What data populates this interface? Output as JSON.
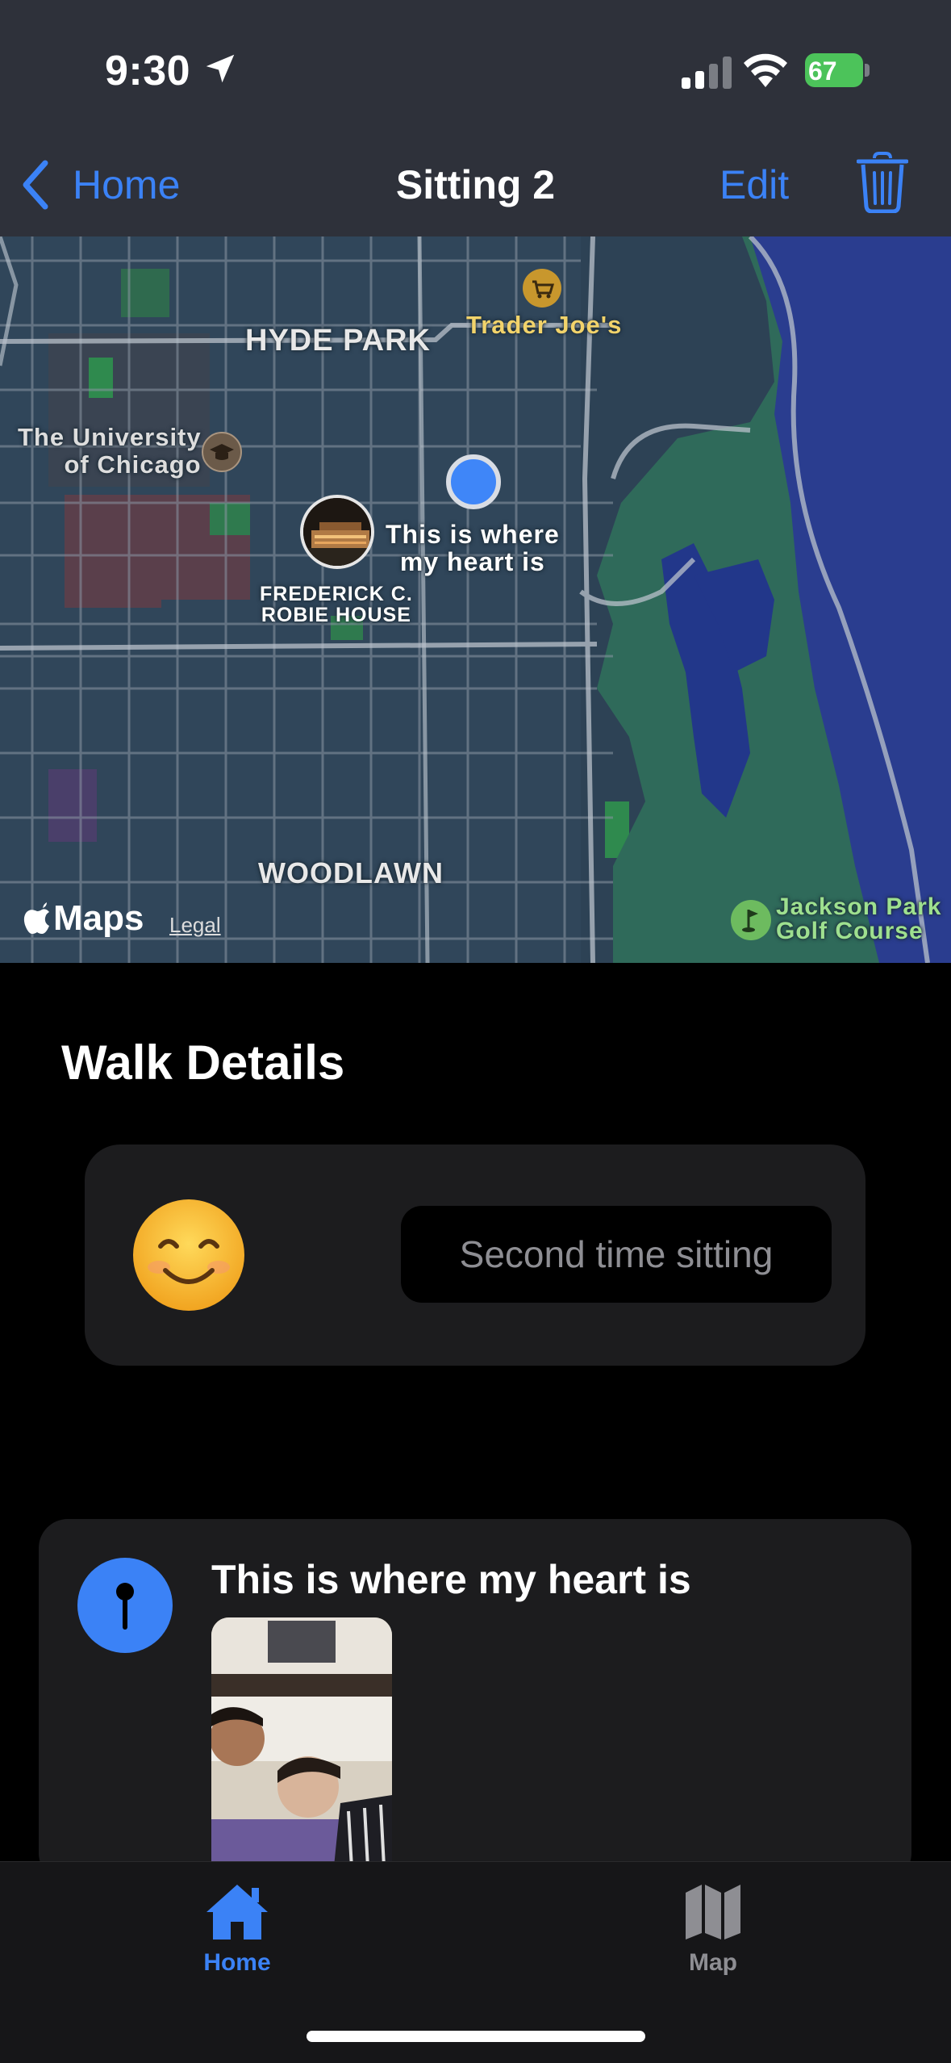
{
  "status_bar": {
    "time": "9:30",
    "battery_percent": "67"
  },
  "nav": {
    "back_label": "Home",
    "title": "Sitting 2",
    "edit_label": "Edit"
  },
  "map": {
    "labels": {
      "hyde_park": "HYDE PARK",
      "woodlawn": "WOODLAWN",
      "trader_joes": "Trader Joe's",
      "university_line1": "The University",
      "university_line2": "of Chicago",
      "robie_line1": "FREDERICK C.",
      "robie_line2": "ROBIE HOUSE",
      "pin_line1": "This is where",
      "pin_line2": "my heart is",
      "jackson_line1": "Jackson Park",
      "jackson_line2": "Golf Course"
    },
    "maps_brand": "Maps",
    "legal": "Legal"
  },
  "walk_details": {
    "title": "Walk Details",
    "note": "Second time sitting",
    "mood_emoji": "smiling-face"
  },
  "entry": {
    "title": "This is where my heart is"
  },
  "tabbar": {
    "home_label": "Home",
    "map_label": "Map"
  },
  "colors": {
    "accent": "#3b82f6",
    "battery": "#4cc35a",
    "card": "#1c1c1e"
  }
}
